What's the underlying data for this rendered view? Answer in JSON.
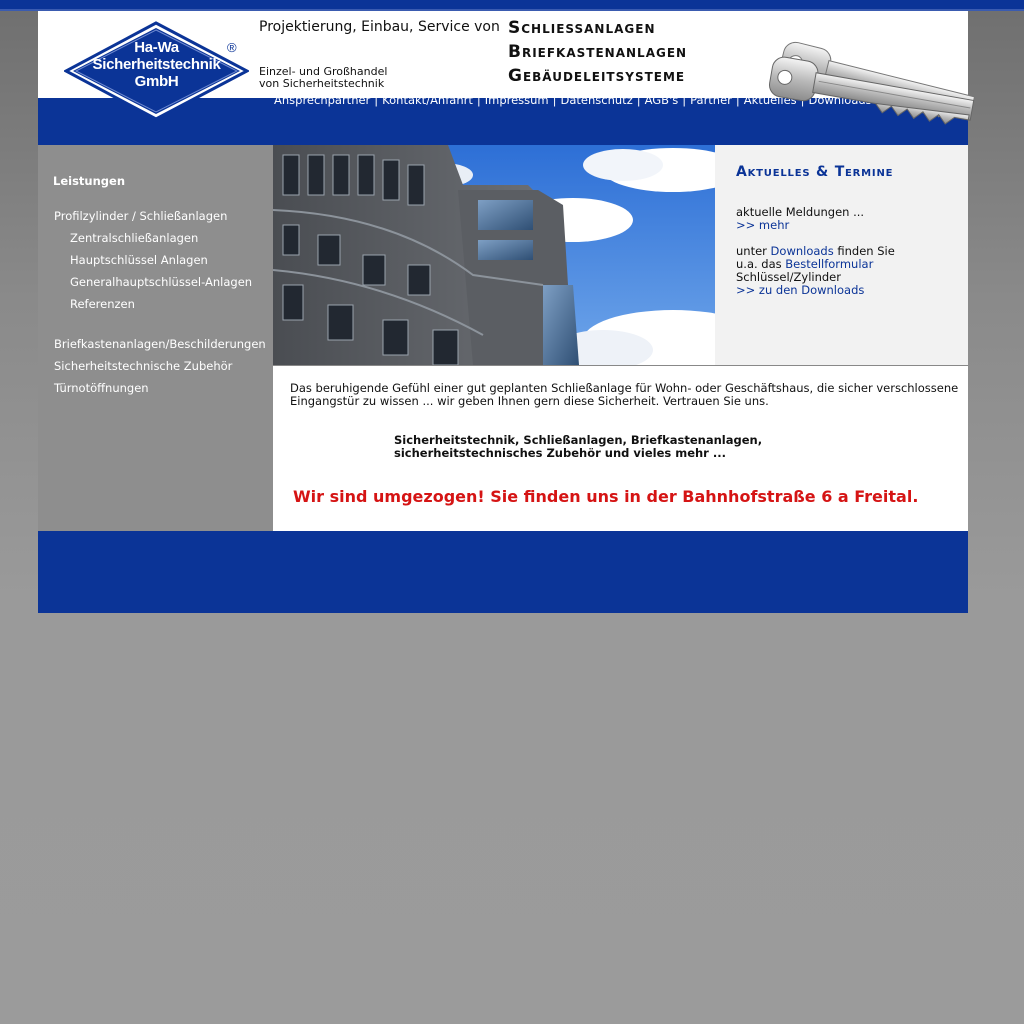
{
  "colors": {
    "brand_blue": "#0b3497",
    "sidebar_gray": "#8e8e8e",
    "news_bg": "#f2f2f2",
    "alert_red": "#d51414",
    "page_bg": "#9b9b9b"
  },
  "header": {
    "logo": {
      "line1": "Ha-Wa",
      "line2": "Sicherheitstechnik",
      "line3": "GmbH",
      "registered": "®"
    },
    "tagline_main": "Projektierung, Einbau, Service von",
    "tagline_sub_1": "Einzel- und Großhandel",
    "tagline_sub_2": "von Sicherheitstechnik",
    "services": [
      "Schliessanlagen",
      "Briefkastenanlagen",
      "Gebäudeleitsysteme"
    ],
    "keys_image": "keys-image"
  },
  "nav": {
    "items": [
      "Ansprechpartner",
      "Kontakt/Anfahrt",
      "Impressum",
      "Datenschutz",
      "AGB's",
      "Partner",
      "Aktuelles",
      "Downloads"
    ],
    "separator": "|"
  },
  "sidebar": {
    "heading": "Leistungen",
    "items": [
      "Profilzylinder / Schließanlagen",
      "Zentralschließanlagen",
      "Hauptschlüssel Anlagen",
      "Generalhauptschlüssel-Anlagen",
      "Referenzen",
      "Briefkastenanlagen/Beschilderungen",
      "Sicherheitstechnische Zubehör",
      "Türnotöffnungen"
    ]
  },
  "news": {
    "title": "Aktuelles & Termine",
    "line1": "aktuelle Meldungen ...",
    "link_more": ">> mehr",
    "p2_a": "unter",
    "p2_link": "Downloads",
    "p2_b": "finden Sie",
    "p2_c": "u.a. das",
    "p2_link2": "Bestellformular",
    "p2_d": "Schlüssel/Zylinder",
    "link_downloads": ">> zu den Downloads"
  },
  "content": {
    "intro": "Das beruhigende Gefühl einer gut geplanten Schließanlage für Wohn- oder Geschäftshaus, die sicher verschlossene Eingangstür zu wissen ... wir geben Ihnen gern diese Sicherheit. Vertrauen Sie uns.",
    "bold_line1": "Sicherheitstechnik, Schließanlagen, Briefkastenanlagen,",
    "bold_line2": "sicherheitstechnisches Zubehör und vieles mehr ...",
    "moved_notice": "Wir sind umgezogen! Sie finden uns in der Bahnhofstraße 6 a Freital."
  }
}
